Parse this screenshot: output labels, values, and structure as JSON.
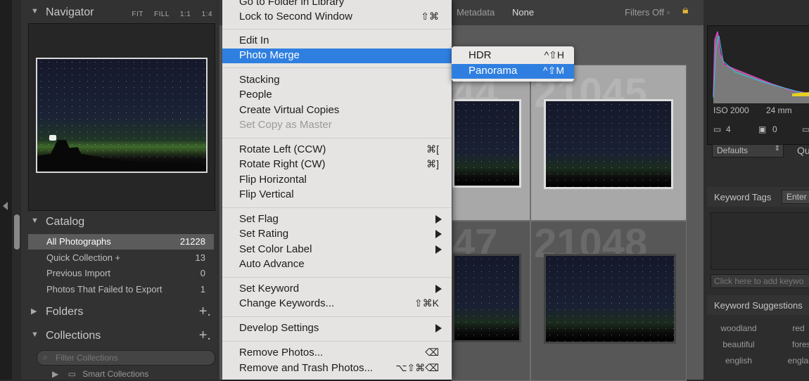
{
  "navigator": {
    "title": "Navigator",
    "tools": [
      "FIT",
      "FILL",
      "1:1",
      "1:4"
    ]
  },
  "catalog": {
    "title": "Catalog",
    "items": [
      {
        "label": "All Photographs",
        "count": "21228"
      },
      {
        "label": "Quick Collection +",
        "count": "13"
      },
      {
        "label": "Previous Import",
        "count": "0"
      },
      {
        "label": "Photos That Failed to Export",
        "count": "1"
      }
    ]
  },
  "folders": {
    "title": "Folders",
    "plus": "+."
  },
  "collections": {
    "title": "Collections",
    "plus": "+.",
    "filter_placeholder": "Filter Collections",
    "smart_label": "Smart Collections"
  },
  "filterbar": {
    "metadata": "Metadata",
    "none": "None",
    "filters_off": "Filters Off ◦"
  },
  "grid": {
    "cells": [
      {
        "num": "44"
      },
      {
        "num": "21045"
      },
      {
        "num": "47"
      },
      {
        "num": "21048"
      }
    ]
  },
  "menu": {
    "items": [
      {
        "label": "Go to Folder in Library",
        "shortcut": ""
      },
      {
        "label": "Lock to Second Window",
        "shortcut": "⇧⌘"
      },
      {
        "label": "Edit In",
        "shortcut": ""
      },
      {
        "label": "Photo Merge",
        "shortcut": ""
      },
      {
        "label": "Stacking",
        "shortcut": ""
      },
      {
        "label": "People",
        "shortcut": ""
      },
      {
        "label": "Create Virtual Copies",
        "shortcut": ""
      },
      {
        "label": "Set Copy as Master",
        "shortcut": ""
      },
      {
        "label": "Rotate Left (CCW)",
        "shortcut": "⌘["
      },
      {
        "label": "Rotate Right (CW)",
        "shortcut": "⌘]"
      },
      {
        "label": "Flip Horizontal",
        "shortcut": ""
      },
      {
        "label": "Flip Vertical",
        "shortcut": ""
      },
      {
        "label": "Set Flag",
        "shortcut": ""
      },
      {
        "label": "Set Rating",
        "shortcut": ""
      },
      {
        "label": "Set Color Label",
        "shortcut": ""
      },
      {
        "label": "Auto Advance",
        "shortcut": ""
      },
      {
        "label": "Set Keyword",
        "shortcut": ""
      },
      {
        "label": "Change Keywords...",
        "shortcut": "⇧⌘K"
      },
      {
        "label": "Develop Settings",
        "shortcut": ""
      },
      {
        "label": "Remove Photos...",
        "shortcut": "⌫"
      },
      {
        "label": "Remove and Trash Photos...",
        "shortcut": "⌥⇧⌘⌫"
      }
    ]
  },
  "submenu": {
    "items": [
      {
        "label": "HDR",
        "shortcut": "^⇧H"
      },
      {
        "label": "Panorama",
        "shortcut": "^⇧M"
      }
    ]
  },
  "rightpanel": {
    "iso": "ISO 2000",
    "focal": "24 mm",
    "val1": "4",
    "val2": "0",
    "defaults": "Defaults",
    "qu": "Qu",
    "keyword_tags": "Keyword Tags",
    "enter": "Enter",
    "add_keywords_placeholder": "Click here to add keywo",
    "keyword_suggestions": "Keyword Suggestions",
    "suggestions": [
      "woodland",
      "red",
      "beautiful",
      "forest",
      "english",
      "england"
    ]
  }
}
